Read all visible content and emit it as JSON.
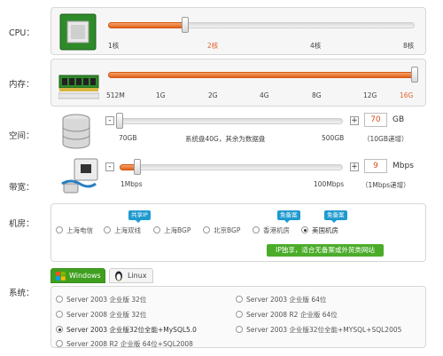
{
  "labels": {
    "cpu": "CPU：",
    "memory": "内存：",
    "disk": "空间：",
    "bandwidth": "带宽：",
    "room": "机房：",
    "system": "系统："
  },
  "cpu": {
    "ticks": [
      "1核",
      "2核",
      "4核",
      "8核"
    ],
    "selected": "2核",
    "level": 0.25
  },
  "memory": {
    "ticks": [
      "512M",
      "1G",
      "2G",
      "4G",
      "8G",
      "12G",
      "16G"
    ],
    "selected": "16G",
    "level": 1.0
  },
  "disk": {
    "min_label": "70GB",
    "max_label": "500GB",
    "note": "系统盘40G，其余为数据盘",
    "minus": "-",
    "plus": "+",
    "value": "70",
    "unit": "GB",
    "step_note": "（10GB递增）",
    "level": 0.0
  },
  "bandwidth": {
    "min_label": "1Mbps",
    "max_label": "100Mbps",
    "minus": "-",
    "plus": "+",
    "value": "9",
    "unit": "Mbps",
    "step_note": "（1Mbps递增）",
    "level": 0.08
  },
  "rooms": {
    "options": [
      "上海电信",
      "上海双线",
      "上海BGP",
      "北京BGP",
      "香港机房",
      "美国机房"
    ],
    "selected": "美国机房",
    "badges": {
      "shared_ip": "共享IP",
      "no_filing_1": "免备案",
      "no_filing_2": "免备案"
    },
    "tip": "IP独享，适合无备案或外贸类网站"
  },
  "system": {
    "tabs": [
      "Windows",
      "Linux"
    ],
    "active_tab": "Windows",
    "left_options": [
      "Server 2003 企业版 32位",
      "Server 2008 企业版 32位",
      "Server 2003 企业版32位全能+MySQL5.0",
      "Server 2008 R2 企业版 64位+SQL2008"
    ],
    "right_options": [
      "Server 2003 企业版 64位",
      "Server 2008 R2 企业版 64位",
      "Server 2003 企业版32位全能+MYSQL+SQL2005"
    ],
    "selected": "Server 2003 企业版32位全能+MySQL5.0"
  },
  "colors": {
    "accent": "#e0621b",
    "badge": "#1f9ad0",
    "tip_green": "#4bac2a",
    "windows_tab": "#3f9f1f"
  },
  "icons": {
    "cpu": "cpu-chip-icon",
    "memory": "memory-module-icon",
    "disk": "disk-stack-icon",
    "bandwidth": "network-port-icon",
    "windows": "windows-logo-icon",
    "linux": "penguin-icon"
  }
}
